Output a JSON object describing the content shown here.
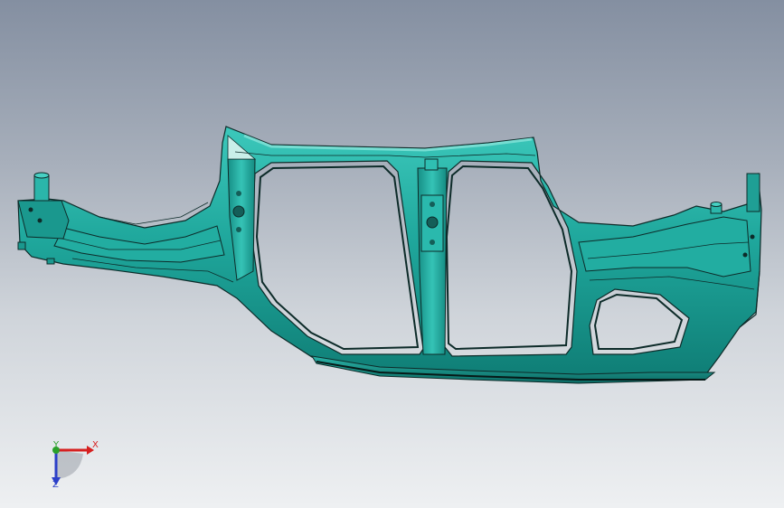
{
  "view": {
    "background_top": "#848fa1",
    "background_bottom": "#eef0f2",
    "part_color": "#1fa79c",
    "edge_color": "#0d2b29"
  },
  "triad": {
    "x_label": "X",
    "y_label": "Y",
    "z_label": "Z",
    "x_color": "#d62020",
    "y_color": "#2aa02a",
    "z_color": "#2b3fc8"
  }
}
